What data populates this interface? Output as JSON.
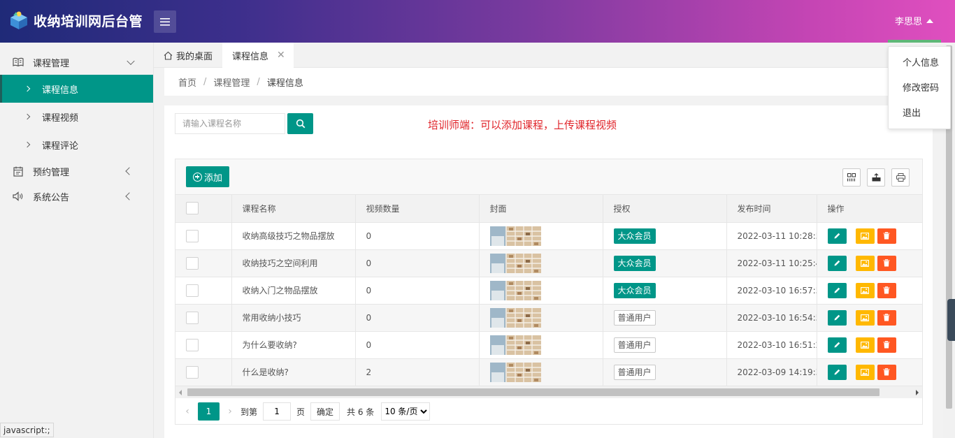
{
  "app": {
    "title": "收纳培训网后台管",
    "user_name": "李思思"
  },
  "user_dropdown": [
    "个人信息",
    "修改密码",
    "退出"
  ],
  "sidebar": {
    "groups": [
      {
        "label": "课程管理",
        "icon": "book-icon",
        "expanded": true,
        "items": [
          {
            "label": "课程信息",
            "active": true
          },
          {
            "label": "课程视频",
            "active": false
          },
          {
            "label": "课程评论",
            "active": false
          }
        ]
      },
      {
        "label": "预约管理",
        "icon": "calendar-icon",
        "expanded": false
      },
      {
        "label": "系统公告",
        "icon": "speaker-icon",
        "expanded": false
      }
    ]
  },
  "tabs": {
    "home": "我的桌面",
    "current": "课程信息"
  },
  "breadcrumb": [
    "首页",
    "课程管理",
    "课程信息"
  ],
  "search": {
    "placeholder": "请输入课程名称"
  },
  "note": "培训师端：可以添加课程，上传课程视频",
  "toolbar": {
    "add_label": "添加"
  },
  "table": {
    "columns": [
      "课程名称",
      "视频数量",
      "封面",
      "授权",
      "发布时间",
      "操作"
    ],
    "rows": [
      {
        "name": "收纳高级技巧之物品摆放",
        "videos": "0",
        "auth": "大众会员",
        "auth_type": "vip",
        "time": "2022-03-11 10:28:58"
      },
      {
        "name": "收纳技巧之空间利用",
        "videos": "0",
        "auth": "大众会员",
        "auth_type": "vip",
        "time": "2022-03-11 10:25:49"
      },
      {
        "name": "收纳入门之物品摆放",
        "videos": "0",
        "auth": "大众会员",
        "auth_type": "vip",
        "time": "2022-03-10 16:57:53"
      },
      {
        "name": "常用收纳小技巧",
        "videos": "0",
        "auth": "普通用户",
        "auth_type": "normal",
        "time": "2022-03-10 16:54:54"
      },
      {
        "name": "为什么要收纳?",
        "videos": "0",
        "auth": "普通用户",
        "auth_type": "normal",
        "time": "2022-03-10 16:51:24"
      },
      {
        "name": "什么是收纳?",
        "videos": "2",
        "auth": "普通用户",
        "auth_type": "normal",
        "time": "2022-03-09 14:19:33"
      }
    ]
  },
  "pager": {
    "current": "1",
    "goto_label": "到第",
    "page_input": "1",
    "page_unit": "页",
    "confirm": "确定",
    "total": "共 6 条",
    "page_size": "10 条/页"
  },
  "status_bar": "javascript:;",
  "colors": {
    "primary": "#009688",
    "warn": "#ffb800",
    "danger": "#ff5722",
    "note": "#e0242a"
  }
}
